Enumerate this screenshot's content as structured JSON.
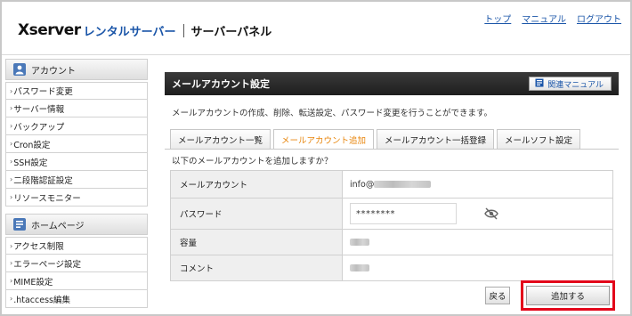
{
  "header": {
    "logo_brand": "Xserver",
    "logo_service": "レンタルサーバー",
    "logo_panel": "サーバーパネル",
    "links": [
      "トップ",
      "マニュアル",
      "ログアウト"
    ]
  },
  "sidebar": {
    "sections": [
      {
        "title": "アカウント",
        "icon": "person-icon",
        "items": [
          "パスワード変更",
          "サーバー情報",
          "バックアップ",
          "Cron設定",
          "SSH設定",
          "二段階認証設定",
          "リソースモニター"
        ]
      },
      {
        "title": "ホームページ",
        "icon": "document-icon",
        "items": [
          "アクセス制限",
          "エラーページ設定",
          "MIME設定",
          ".htaccess編集"
        ]
      }
    ]
  },
  "main": {
    "title": "メールアカウント設定",
    "manual_button": "関連マニュアル",
    "description": "メールアカウントの作成、削除、転送設定、パスワード変更を行うことができます。",
    "tabs": [
      "メールアカウント一覧",
      "メールアカウント追加",
      "メールアカウント一括登録",
      "メールソフト設定"
    ],
    "active_tab": 1,
    "question": "以下のメールアカウントを追加しますか？",
    "fields": {
      "account_label": "メールアカウント",
      "account_prefix": "info@",
      "password_label": "パスワード",
      "password_mask": "********",
      "capacity_label": "容量",
      "comment_label": "コメント"
    },
    "back_button": "戻る",
    "add_button": "追加する"
  },
  "colors": {
    "active_tab": "#e8860d",
    "link": "#1a55a8",
    "highlight_border": "#e3061b",
    "title_bar": "#262626"
  }
}
